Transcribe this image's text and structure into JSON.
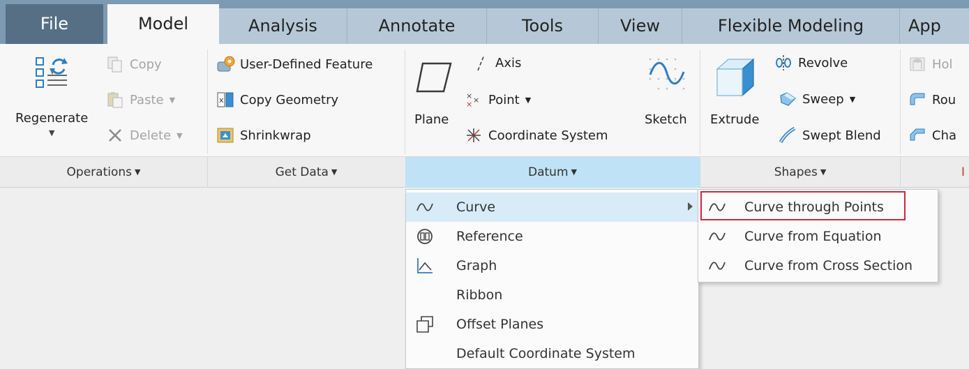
{
  "tabs": {
    "file": "File",
    "model": "Model",
    "analysis": "Analysis",
    "annotate": "Annotate",
    "tools": "Tools",
    "view": "View",
    "flexible": "Flexible Modeling",
    "app": "App"
  },
  "operations": {
    "regenerate": "Regenerate",
    "copy": "Copy",
    "paste": "Paste",
    "delete": "Delete",
    "title": "Operations"
  },
  "get_data": {
    "udf": "User-Defined Feature",
    "copy_geometry": "Copy Geometry",
    "shrinkwrap": "Shrinkwrap",
    "title": "Get Data"
  },
  "datum": {
    "plane": "Plane",
    "axis": "Axis",
    "point": "Point",
    "csys": "Coordinate System",
    "sketch": "Sketch",
    "title": "Datum"
  },
  "shapes": {
    "extrude": "Extrude",
    "revolve": "Revolve",
    "sweep": "Sweep",
    "swept_blend": "Swept Blend",
    "title": "Shapes"
  },
  "engineering": {
    "hole": "Hol",
    "round": "Rou",
    "chamfer": "Cha",
    "title": "I"
  },
  "datum_menu": {
    "curve": "Curve",
    "reference": "Reference",
    "graph": "Graph",
    "ribbon": "Ribbon",
    "offset_planes": "Offset Planes",
    "default_csys": "Default Coordinate System"
  },
  "curve_submenu": {
    "through_points": "Curve through Points",
    "from_equation": "Curve from Equation",
    "from_cross_section": "Curve from Cross Section"
  },
  "colors": {
    "tabbar": "#7c9bb3",
    "file_tab": "#566f85",
    "datum_highlight": "#bfe2f6",
    "menu_highlight": "#d8ecf8",
    "annotation_box": "#d0283a"
  }
}
